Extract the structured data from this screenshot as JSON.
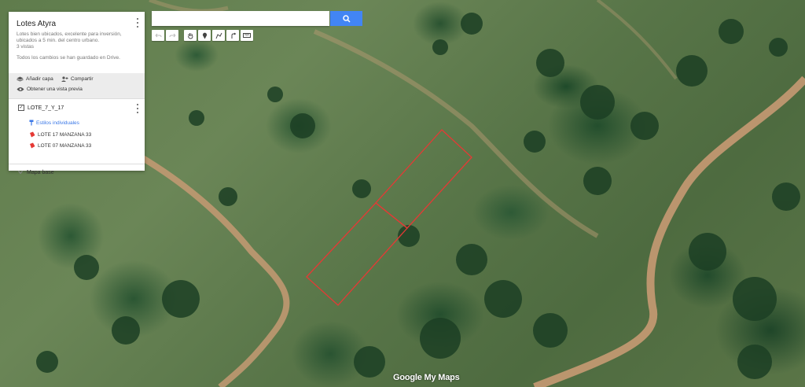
{
  "map": {
    "title": "Lotes Atyra",
    "description": "Lotes bien ubicados, excelente para inversión, ubicados a 5 min. del centro urbano.",
    "views": "3 vistas",
    "saved_status": "Todos los cambios se han guardado en Drive."
  },
  "actions": {
    "add_layer": "Añadir capa",
    "share": "Compartir",
    "preview": "Obtener una vista previa"
  },
  "layer": {
    "name": "LOTE_7_Y_17",
    "checked": true,
    "style_link": "Estilos individuales",
    "features": [
      "LOTE 17 MANZANA 33",
      "LOTE 07 MANZANA 33"
    ],
    "feature_color": "#e53935"
  },
  "basemap": {
    "label": "Mapa base"
  },
  "search": {
    "value": "",
    "placeholder": ""
  },
  "toolbar": {
    "tools": [
      "undo-icon",
      "redo-icon",
      "hand-icon",
      "marker-icon",
      "draw-line-icon",
      "directions-icon",
      "ruler-icon"
    ]
  },
  "footer": {
    "logo": "Google My Maps"
  },
  "colors": {
    "accent": "#4285f4",
    "polygon": "#e53935",
    "road": "#c69a73"
  }
}
